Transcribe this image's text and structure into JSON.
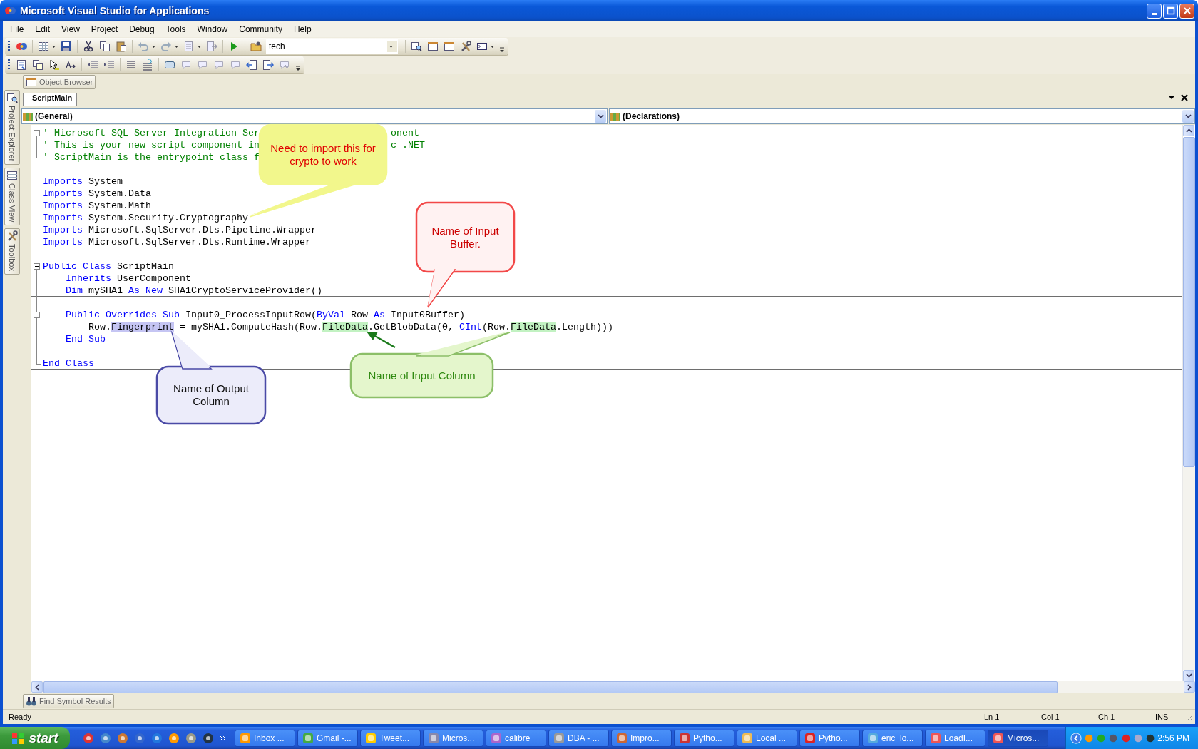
{
  "window": {
    "title": "Microsoft Visual Studio for Applications"
  },
  "menu": [
    "File",
    "Edit",
    "View",
    "Project",
    "Debug",
    "Tools",
    "Window",
    "Community",
    "Help"
  ],
  "toolbar": {
    "configuration": "tech"
  },
  "tool_tabs": {
    "top": [
      "Object Browser"
    ],
    "left": [
      "Project Explorer",
      "Class View",
      "Toolbox"
    ],
    "bottom": [
      "Find Symbol Results"
    ]
  },
  "editor": {
    "tabs": [
      {
        "label": "ScriptMain",
        "selected": true
      }
    ],
    "object_dropdown": "(General)",
    "procedure_dropdown": "(Declarations)",
    "lines": [
      {
        "kind": "code",
        "collapsible": true,
        "block_end": false,
        "separator": false,
        "tokens": [
          {
            "kind": "comment",
            "text": "' Microsoft SQL Server Integration Ser"
          },
          {
            "kind": "comment-after-callout",
            "text": "onent"
          }
        ]
      },
      {
        "kind": "code",
        "collapsible": false,
        "block_end": false,
        "separator": false,
        "tokens": [
          {
            "kind": "comment",
            "text": "' This is your new script component in"
          },
          {
            "kind": "comment-after-callout",
            "text": "c .NET"
          }
        ]
      },
      {
        "kind": "code",
        "collapsible": false,
        "block_end": true,
        "separator": false,
        "tokens": [
          {
            "kind": "comment",
            "text": "' ScriptMain is the entrypoint class f"
          }
        ]
      },
      {
        "kind": "blank",
        "collapsible": false,
        "block_end": false,
        "separator": false
      },
      {
        "kind": "code",
        "collapsible": false,
        "block_end": false,
        "separator": false,
        "tokens": [
          {
            "kind": "keyword",
            "text": "Imports"
          },
          {
            "kind": "plain",
            "text": " System"
          }
        ]
      },
      {
        "kind": "code",
        "collapsible": false,
        "block_end": false,
        "separator": false,
        "tokens": [
          {
            "kind": "keyword",
            "text": "Imports"
          },
          {
            "kind": "plain",
            "text": " System.Data"
          }
        ]
      },
      {
        "kind": "code",
        "collapsible": false,
        "block_end": false,
        "separator": false,
        "tokens": [
          {
            "kind": "keyword",
            "text": "Imports"
          },
          {
            "kind": "plain",
            "text": " System.Math"
          }
        ]
      },
      {
        "kind": "code",
        "collapsible": false,
        "block_end": false,
        "separator": false,
        "tokens": [
          {
            "kind": "keyword",
            "text": "Imports"
          },
          {
            "kind": "plain",
            "text": " System.Security.Cryptography"
          }
        ]
      },
      {
        "kind": "code",
        "collapsible": false,
        "block_end": false,
        "separator": false,
        "tokens": [
          {
            "kind": "keyword",
            "text": "Imports"
          },
          {
            "kind": "plain",
            "text": " Microsoft.SqlServer.Dts.Pipeline.Wrapper"
          }
        ]
      },
      {
        "kind": "code",
        "collapsible": false,
        "block_end": false,
        "separator": true,
        "tokens": [
          {
            "kind": "keyword",
            "text": "Imports"
          },
          {
            "kind": "plain",
            "text": " Microsoft.SqlServer.Dts.Runtime.Wrapper"
          }
        ]
      },
      {
        "kind": "blank",
        "collapsible": false,
        "block_end": false,
        "separator": false
      },
      {
        "kind": "code",
        "collapsible": true,
        "block_end": false,
        "separator": false,
        "tokens": [
          {
            "kind": "keyword",
            "text": "Public"
          },
          {
            "kind": "keyword",
            "text": " Class"
          },
          {
            "kind": "plain",
            "text": " ScriptMain"
          }
        ]
      },
      {
        "kind": "code",
        "collapsible": false,
        "block_end": false,
        "separator": false,
        "tokens": [
          {
            "kind": "keyword",
            "text": "    Inherits"
          },
          {
            "kind": "plain",
            "text": " UserComponent"
          }
        ]
      },
      {
        "kind": "code",
        "collapsible": false,
        "block_end": false,
        "separator": true,
        "tokens": [
          {
            "kind": "keyword",
            "text": "    Dim"
          },
          {
            "kind": "plain",
            "text": " mySHA1 "
          },
          {
            "kind": "keyword",
            "text": "As"
          },
          {
            "kind": "keyword",
            "text": " New"
          },
          {
            "kind": "plain",
            "text": " SHA1CryptoServiceProvider()"
          }
        ]
      },
      {
        "kind": "blank",
        "collapsible": false,
        "block_end": false,
        "separator": false
      },
      {
        "kind": "code",
        "collapsible": true,
        "block_end": false,
        "separator": false,
        "tokens": [
          {
            "kind": "keyword",
            "text": "    Public"
          },
          {
            "kind": "keyword",
            "text": " Overrides"
          },
          {
            "kind": "keyword",
            "text": " Sub"
          },
          {
            "kind": "plain",
            "text": " Input0_ProcessInputRow("
          },
          {
            "kind": "keyword",
            "text": "ByVal"
          },
          {
            "kind": "plain",
            "text": " Row "
          },
          {
            "kind": "keyword",
            "text": "As"
          },
          {
            "kind": "plain",
            "text": " Input0Buffer)"
          }
        ]
      },
      {
        "kind": "code",
        "collapsible": false,
        "block_end": false,
        "separator": false,
        "tokens": [
          {
            "kind": "plain",
            "text": "        Row."
          },
          {
            "kind": "output-highlight",
            "text": "Fingerprint"
          },
          {
            "kind": "plain",
            "text": " = mySHA1.ComputeHash(Row."
          },
          {
            "kind": "input-highlight",
            "text": "FileData"
          },
          {
            "kind": "plain",
            "text": ".GetBlobData(0, "
          },
          {
            "kind": "keyword",
            "text": "CInt"
          },
          {
            "kind": "plain",
            "text": "(Row."
          },
          {
            "kind": "input-highlight",
            "text": "FileData"
          },
          {
            "kind": "plain",
            "text": ".Length)))"
          }
        ]
      },
      {
        "kind": "code",
        "collapsible": false,
        "block_end": true,
        "separator": false,
        "tokens": [
          {
            "kind": "keyword",
            "text": "    End Sub"
          }
        ]
      },
      {
        "kind": "blank",
        "collapsible": false,
        "block_end": false,
        "separator": false
      },
      {
        "kind": "code",
        "collapsible": false,
        "block_end": true,
        "separator": true,
        "tokens": [
          {
            "kind": "keyword",
            "text": "End Class"
          }
        ]
      }
    ]
  },
  "callouts": [
    {
      "kind": "yellow",
      "text": "Need to import this for crypto to work"
    },
    {
      "kind": "red",
      "text": "Name of Input Buffer."
    },
    {
      "kind": "blue",
      "text": "Name of Output Column"
    },
    {
      "kind": "green",
      "text": "Name of Input Column"
    }
  ],
  "status_bar": {
    "message": "Ready",
    "line": "Ln 1",
    "column": "Col 1",
    "character": "Ch 1",
    "mode": "INS"
  },
  "taskbar": {
    "start": "start",
    "tasks": [
      {
        "label": "Inbox ...",
        "selected": false
      },
      {
        "label": "Gmail -...",
        "selected": false
      },
      {
        "label": "Tweet...",
        "selected": false
      },
      {
        "label": "Micros...",
        "selected": false
      },
      {
        "label": "calibre",
        "selected": false
      },
      {
        "label": "DBA - ...",
        "selected": false
      },
      {
        "label": "Impro...",
        "selected": false
      },
      {
        "label": "Pytho...",
        "selected": false
      },
      {
        "label": "Local ...",
        "selected": false
      },
      {
        "label": "Pytho...",
        "selected": false
      },
      {
        "label": "eric_lo...",
        "selected": false
      },
      {
        "label": "LoadI...",
        "selected": false
      },
      {
        "label": "Micros...",
        "selected": true
      }
    ],
    "clock": "2:56 PM"
  }
}
